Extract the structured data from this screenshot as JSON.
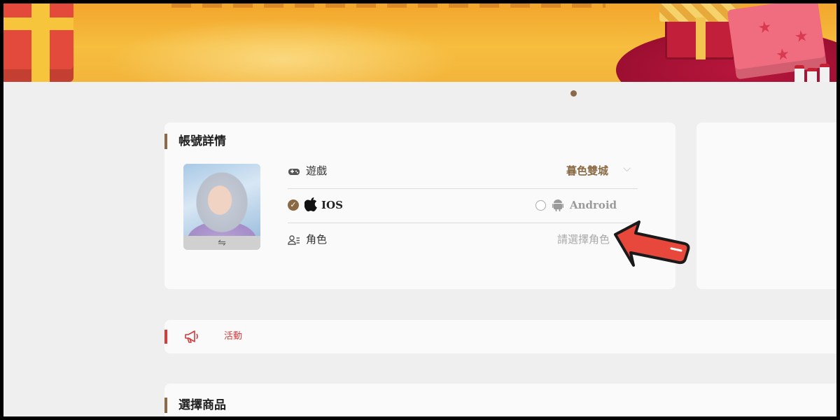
{
  "account": {
    "title": "帳號詳情",
    "switch_glyph": "⇋",
    "game_label": "遊戲",
    "game_value": "暮色雙城",
    "platform_ios": "IOS",
    "platform_android": "Android",
    "role_label": "角色",
    "role_placeholder": "請選擇角色"
  },
  "activity": {
    "label": "活動"
  },
  "products": {
    "title": "選擇商品"
  },
  "colors": {
    "accent_brown": "#8a6a44",
    "activity_red": "#d63a3a",
    "pointer_red": "#e8483b"
  },
  "icons": [
    "gamepad-icon",
    "check-icon",
    "apple-icon",
    "android-icon",
    "user-list-icon",
    "chevron-down-icon",
    "swap-icon",
    "megaphone-icon",
    "arrow-pointer-icon"
  ]
}
